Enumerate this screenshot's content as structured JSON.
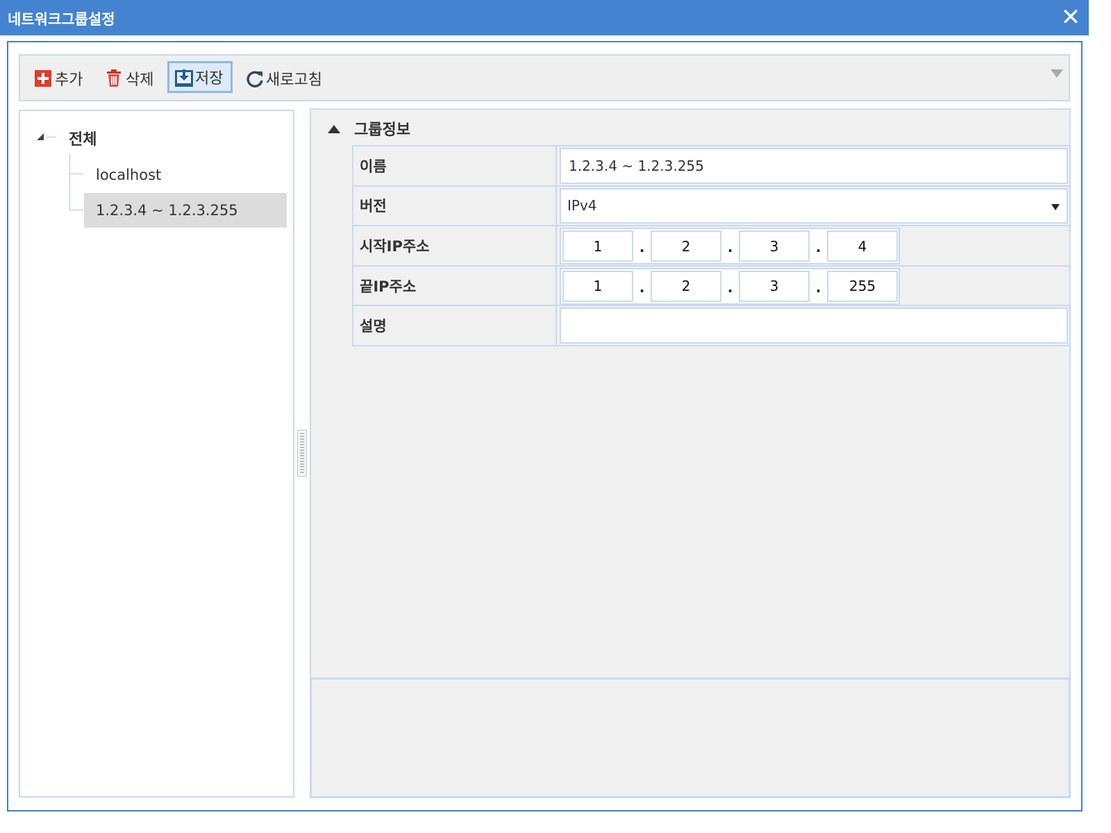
{
  "window": {
    "title": "네트워크그룹설정",
    "close_icon": "close-icon"
  },
  "toolbar": {
    "add_label": "추가",
    "delete_label": "삭제",
    "save_label": "저장",
    "refresh_label": "새로고침",
    "add_color": "#e03c2d",
    "delete_color": "#c0392b",
    "save_color": "#1f5f8b"
  },
  "tree": {
    "root_label": "전체",
    "items": [
      {
        "label": "localhost"
      },
      {
        "label": "1.2.3.4 ~ 1.2.3.255"
      }
    ],
    "selected_index": 1
  },
  "group_info": {
    "section_title": "그룹정보",
    "name_label": "이름",
    "name_value": "1.2.3.4 ~ 1.2.3.255",
    "version_label": "버전",
    "version_value": "IPv4",
    "start_ip_label": "시작IP주소",
    "start_ip": [
      "1",
      "2",
      "3",
      "4"
    ],
    "end_ip_label": "끝IP주소",
    "end_ip": [
      "1",
      "2",
      "3",
      "255"
    ],
    "desc_label": "설명",
    "desc_value": "",
    "ip_separator": "."
  },
  "colors": {
    "titlebar": "#4383d0",
    "border": "#c8daf0",
    "selected_item": "#dcdcdc"
  }
}
